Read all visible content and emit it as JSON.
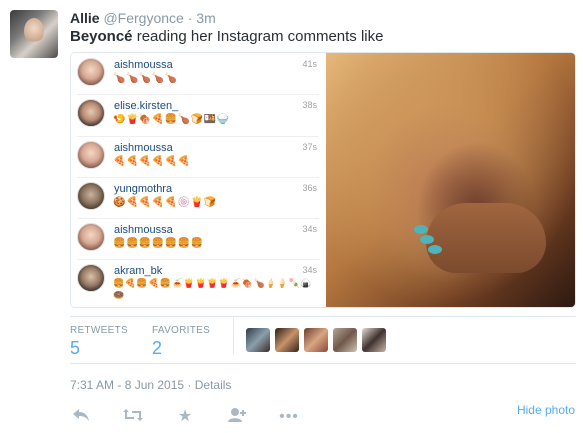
{
  "tweet": {
    "name": "Allie",
    "handle": "@Fergyonce",
    "time": "3m",
    "text_bold": "Beyoncé",
    "text_rest": " reading her Instagram comments like"
  },
  "comments": [
    {
      "user": "aishmoussa",
      "time": "41s",
      "emoji": "🍗🍗🍗🍗🍗"
    },
    {
      "user": "elise.kirsten_",
      "time": "38s",
      "emoji": "🍤🍟🍖🍕🍔🍗🍞🍱🍚"
    },
    {
      "user": "aishmoussa",
      "time": "37s",
      "emoji": "🍕🍕🍕🍕🍕🍕"
    },
    {
      "user": "yungmothra",
      "time": "36s",
      "emoji": "🍪🍕🍕🍕🍕🍥🍟🍞"
    },
    {
      "user": "aishmoussa",
      "time": "34s",
      "emoji": "🍔🍔🍔🍔🍔🍔🍔"
    },
    {
      "user": "akram_bk",
      "time": "34s",
      "emoji": "🍔🍕🍔🍕🍔🍝🍟🍟🍟🍟🍝🍖🍗🍦🍦🍡🍙🍩"
    }
  ],
  "stats": {
    "retweets_label": "RETWEETS",
    "retweets_value": "5",
    "favorites_label": "FAVORITES",
    "favorites_value": "2"
  },
  "date": "7:31 AM - 8 Jun 2015 · Details",
  "actions": {
    "reply_icon": "reply-icon",
    "retweet_icon": "retweet-icon",
    "favorite_icon": "star-icon",
    "follow_icon": "follow-icon",
    "more_icon": "more-icon",
    "hide_photo": "Hide photo"
  },
  "colors": {
    "accent": "#55acee",
    "muted": "#8899a6",
    "link": "#1d4b7d"
  }
}
